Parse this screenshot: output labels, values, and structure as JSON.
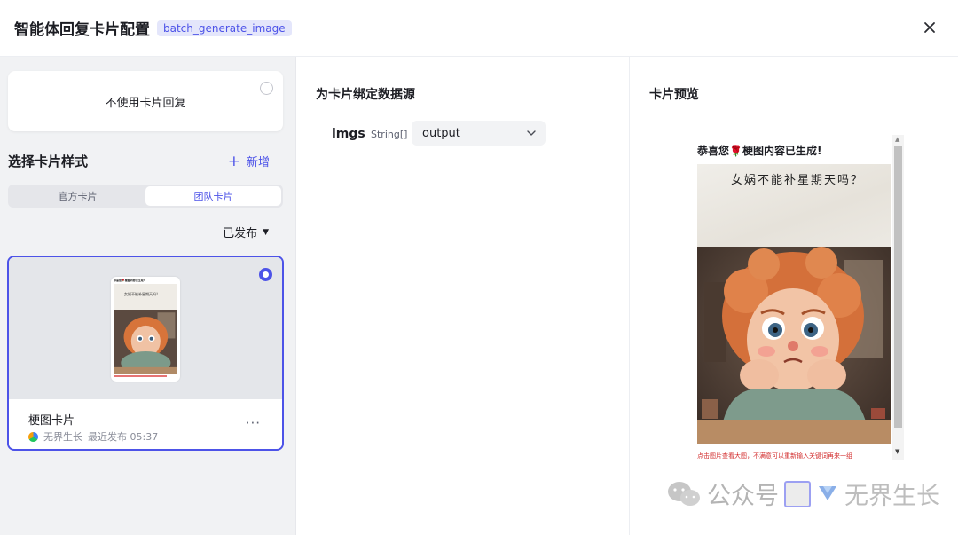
{
  "header": {
    "title": "智能体回复卡片配置",
    "tag": "batch_generate_image"
  },
  "left": {
    "no_card_label": "不使用卡片回复",
    "section_title": "选择卡片样式",
    "add_label": "新增",
    "tabs": [
      {
        "label": "官方卡片",
        "active": false
      },
      {
        "label": "团队卡片",
        "active": true
      }
    ],
    "filter_label": "已发布",
    "card": {
      "name": "梗图卡片",
      "author": "无界生长",
      "published": "最近发布 05:37",
      "more": "···"
    },
    "thumb": {
      "header": "恭喜您🌹梗图内容已生成!",
      "caption": "女娲不能补星期天吗？"
    }
  },
  "middle": {
    "title": "为卡片绑定数据源",
    "field": {
      "name": "imgs",
      "type": "String[]",
      "value": "output"
    }
  },
  "right": {
    "title": "卡片预览",
    "preview": {
      "header_prefix": "恭喜您",
      "header_icon": "🌹",
      "header_suffix": "梗图内容已生成!",
      "caption": "女娲不能补星期天吗？",
      "footer": "点击图片查看大图，不满意可以重新输入关键词再来一组"
    }
  },
  "watermark": {
    "prefix": "公众号",
    "name": "无界生长"
  },
  "colors": {
    "accent": "#4d53e8",
    "panel_bg": "#f1f2f4",
    "tag_bg": "#e4e6fb"
  }
}
